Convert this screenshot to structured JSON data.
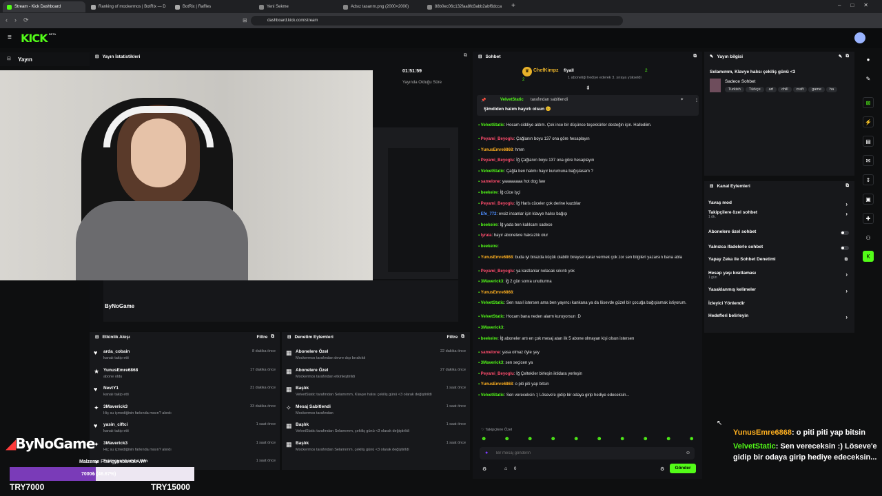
{
  "browser": {
    "tabs": [
      {
        "label": "Stream - Kick Dashboard",
        "active": true
      },
      {
        "label": "Ranking of mockermos | BotRix — D"
      },
      {
        "label": "BotRix | Raffles"
      },
      {
        "label": "Yeni Sekme"
      },
      {
        "label": "Adsız tasarım.png (2000×2000)"
      },
      {
        "label": "88b0ec06c132faa8fd3abb2abf6dcca"
      }
    ],
    "url": "dashboard.kick.com/stream"
  },
  "app": {
    "logo": "KICK",
    "logo_tag": "BETA",
    "section": "Yayın"
  },
  "stats": {
    "title": "Yayın İstatistikleri",
    "time": "01:51:59",
    "time_label": "Yayında Olduğu Süre"
  },
  "overlay": {
    "brand": "ByNoGame",
    "goal_label": "Malzeme",
    "goal_label2": "Fraingyenbambu Wn",
    "progress_text": "7000₺ (46.67%)",
    "progress_fraction": 0.4667,
    "min_label": "TRY7000",
    "max_label": "TRY15000"
  },
  "activity": {
    "title": "Etkinlik Akışı",
    "filter": "Filtre",
    "items": [
      {
        "icon": "heart-icon",
        "name": "arda_cobain",
        "sub": "kanalı takip etti",
        "time": "8 dakika önce"
      },
      {
        "icon": "star-icon",
        "name": "YunusEmre6868",
        "sub": "abone oldu",
        "time": "17 dakika önce"
      },
      {
        "icon": "heart-icon",
        "name": "NevtY1",
        "sub": "kanalı takip etti",
        "time": "31 dakika önce"
      },
      {
        "icon": "gift-icon",
        "name": "3Maverick3",
        "sub": "Hiç su içmediğinin farkında mısın? alındı",
        "time": "33 dakika önce"
      },
      {
        "icon": "heart-icon",
        "name": "yasin_ciftci",
        "sub": "kanalı takip etti",
        "time": "1 saat önce"
      },
      {
        "icon": "gift-icon",
        "name": "3Maverick3",
        "sub": "Hiç su içmediğinin farkında mısın? alındı",
        "time": "1 saat önce"
      },
      {
        "icon": "gift-icon",
        "name": "Fraingyenbambu Wn",
        "sub": "",
        "time": "1 saat önce"
      }
    ]
  },
  "moderation": {
    "title": "Denetim Eylemleri",
    "filter": "Filtre",
    "items": [
      {
        "icon": "grid-icon",
        "name": "Abonelere Özel",
        "sub": "Mockermos tarafından devre dışı bırakıldı",
        "time": "22 dakika önce"
      },
      {
        "icon": "grid-icon",
        "name": "Abonelere Özel",
        "sub": "Mockermos tarafından etkinleştirildi",
        "time": "27 dakika önce"
      },
      {
        "icon": "grid-icon",
        "name": "Başlık",
        "sub": "VelvetStatic tarafından Selamımm, Klavye halısı çekiliş günü <3 olarak değiştirildi",
        "time": "1 saat önce"
      },
      {
        "icon": "pin-icon",
        "name": "Mesaj Sabitlendi",
        "sub": "Mockermos tarafından",
        "time": "1 saat önce"
      },
      {
        "icon": "grid-icon",
        "name": "Başlık",
        "sub": "VelvetStatic tarafından Selamımm, çekiliş günü <3 olarak değiştirildi",
        "time": "1 saat önce"
      },
      {
        "icon": "grid-icon",
        "name": "Başlık",
        "sub": "Mockermos tarafından Selamımm, çekiliş günü <3 olarak değiştirildi",
        "time": "1 saat önce"
      }
    ]
  },
  "chat": {
    "title": "Sohbet",
    "top_gifter": "ChefKimpz",
    "top_gifter_count": "2",
    "gift_user": "fiyall",
    "gift_count": "2",
    "gift_text": "1 aboneliği hediye ederek 3. sıraya yükseldi",
    "pinned_user": "VelvetStatic",
    "pinned_by": "tarafından sabitlendi",
    "pinned_text": "Şimdiden halım hayırlı olsun 😊",
    "messages": [
      {
        "user": "VelvetStatic",
        "color": "#53fc18",
        "text": "Hocam ciddiye aldım. Çok ince bir düşünce teşekkürler desteğin için. Hallediim."
      },
      {
        "user": "Peyami_Beyoglu",
        "color": "#ff4d6d",
        "text": "Çağlanın boyu 137 ona göre hesaplayın"
      },
      {
        "user": "YunusEmre6868",
        "color": "#ffb020",
        "text": "hmm"
      },
      {
        "user": "Peyami_Beyoglu",
        "color": "#ff4d6d",
        "text": "İğ Çağlanın boyu 137 ona göre hesaplayın"
      },
      {
        "user": "VelvetStatic",
        "color": "#53fc18",
        "text": "Çağla ben halımı hayır kurumuna bağışlasam ?"
      },
      {
        "user": "samelone",
        "color": "#ff4d6d",
        "text": "yaaaaaaaa hot dog faw"
      },
      {
        "user": "beekeire",
        "color": "#53fc18",
        "text": "İğ cüce işçi"
      },
      {
        "user": "Peyami_Beyoglu",
        "color": "#ff4d6d",
        "text": "İğ Haris cüceler çok derine kazdılar"
      },
      {
        "user": "Efe_772",
        "color": "#4d8dff",
        "text": "evsiz insanlar için klavye halısı bağışı"
      },
      {
        "user": "beekeire",
        "color": "#53fc18",
        "text": "İğ yada ben kalılcam sadece"
      },
      {
        "user": "lyraia",
        "color": "#ff4d6d",
        "text": "hayır abonelere haksızlık olur"
      },
      {
        "user": "beekeire",
        "color": "#53fc18",
        "text": ""
      },
      {
        "user": "YunusEmre6868",
        "color": "#ffb020",
        "text": "buda iyi birazda küçük olabilir bireysel karar vermek çok zor sen bilgileri yazarsın bana abla"
      },
      {
        "user": "Peyami_Beyoglu",
        "color": "#ff4d6d",
        "text": "ya kastlanlar nolacak sıkıntı yok"
      },
      {
        "user": "3Maverick3",
        "color": "#53fc18",
        "text": "İğ 2 gün sonra unutturma"
      },
      {
        "user": "YunusEmre6868",
        "color": "#ffb020",
        "text": ""
      },
      {
        "user": "VelvetStatic",
        "color": "#53fc18",
        "text": "Sen nasıl istersen ama ben yayıncı kankana ya da lösevde güzel bir çocuğa bağışlamak istiyorum."
      },
      {
        "user": "VelvetStatic",
        "color": "#53fc18",
        "text": "Hocam bana neden alarm kuruyorsun :D"
      },
      {
        "user": "3Maverick3",
        "color": "#53fc18",
        "text": ""
      },
      {
        "user": "beekeire",
        "color": "#53fc18",
        "text": "İğ aboneler artı en çok mesaj atan ilk 5 abone olmayan kişi olsun istersen"
      },
      {
        "user": "samelone",
        "color": "#ff4d6d",
        "text": "yasa olmaz öyle şey"
      },
      {
        "user": "3Maverick3",
        "color": "#53fc18",
        "text": "sen seçicen ya"
      },
      {
        "user": "Peyami_Beyoglu",
        "color": "#ff4d6d",
        "text": "İğ Çeltekiler birleşin iktidara yerleşin"
      },
      {
        "user": "YunusEmre6868",
        "color": "#ffb020",
        "text": "o piti piti yap bitsin"
      },
      {
        "user": "VelvetStatic",
        "color": "#53fc18",
        "text": "Sen vereceksin :) Löseve'e gidip bir odaya girip hediye edeceksin..."
      }
    ],
    "followers_label": "Takipçilere Özel",
    "input_placeholder": "Bir mesaj gönderin",
    "send_label": "Gönder",
    "count": "0"
  },
  "stream_info": {
    "title": "Yayın bilgisi",
    "stream_title": "Selamımm, Klavye halısı çekiliş günü <3",
    "category": "Sadece Sohbet",
    "tags": [
      "Turkish",
      "Türkçe",
      "art",
      "chill",
      "craft",
      "game",
      "ha"
    ]
  },
  "channel_actions": {
    "title": "Kanal Eylemleri",
    "rows": [
      {
        "label": "Yavaş mod",
        "sub": "",
        "control": "chevron"
      },
      {
        "label": "Takipçilere özel sohbet",
        "sub": "1 dk.",
        "control": "chevron"
      },
      {
        "label": "Abonelere özel sohbet",
        "sub": "",
        "control": "toggle"
      },
      {
        "label": "Yalnızca ifadelerle sohbet",
        "sub": "",
        "control": "toggle"
      },
      {
        "label": "Yapay Zeka ile Sohbet Denetimi",
        "sub": "",
        "control": "external"
      },
      {
        "label": "Hesap yaşı kısıtlaması",
        "sub": "1 gün",
        "control": "chevron"
      },
      {
        "label": "Yasaklanmış kelimeler",
        "sub": "",
        "control": "chevron"
      },
      {
        "label": "İzleyici Yönlendir",
        "sub": "",
        "control": "none"
      },
      {
        "label": "Hedefleri belirleyin",
        "sub": "",
        "control": "chevron"
      }
    ]
  },
  "overlay_chat": [
    {
      "user": "YunusEmre6868",
      "color": "#ffb020",
      "text": ": o piti piti yap bitsin"
    },
    {
      "user": "VelvetStatic",
      "color": "#53fc18",
      "text": ": Sen vereceksin :) Löseve'e gidip bir odaya girip hediye edeceksin..."
    }
  ]
}
